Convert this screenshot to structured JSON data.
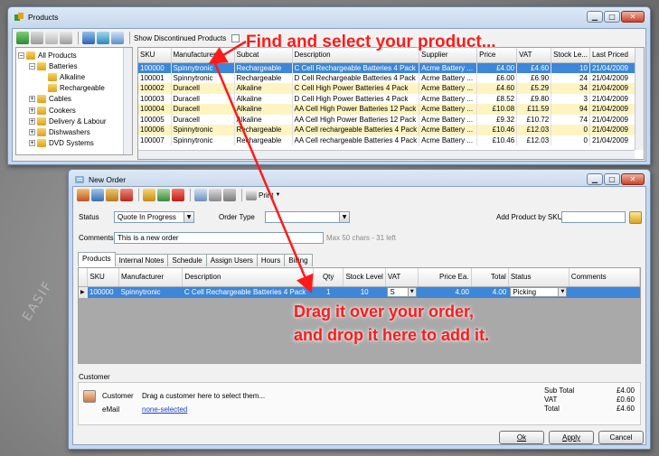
{
  "watermark": "EASIF",
  "products_window": {
    "title": "Products",
    "show_discontinued_label": "Show Discontinued Products",
    "tree": [
      {
        "label": "All Products",
        "expander": "−"
      },
      {
        "label": "Batteries",
        "expander": "−"
      },
      {
        "label": "Alkaline",
        "expander": ""
      },
      {
        "label": "Rechargeable",
        "expander": ""
      },
      {
        "label": "Cables",
        "expander": "+"
      },
      {
        "label": "Cookers",
        "expander": "+"
      },
      {
        "label": "Delivery & Labour",
        "expander": "+"
      },
      {
        "label": "Dishwashers",
        "expander": "+"
      },
      {
        "label": "DVD Systems",
        "expander": "+"
      }
    ],
    "columns": [
      "SKU",
      "Manufacturer",
      "Subcat",
      "Description",
      "Supplier",
      "Price",
      "VAT",
      "Stock Le...",
      "Last Priced"
    ],
    "rows": [
      [
        "100000",
        "Spinnytronic",
        "Rechargeable",
        "C Cell Rechargeable Batteries 4 Pack",
        "Acme Battery ...",
        "£4.00",
        "£4.60",
        "10",
        "21/04/2009"
      ],
      [
        "100001",
        "Spinnytronic",
        "Rechargeable",
        "D Cell Rechargeable Batteries 4 Pack",
        "Acme Battery ...",
        "£6.00",
        "£6.90",
        "24",
        "21/04/2009"
      ],
      [
        "100002",
        "Duracell",
        "Alkaline",
        "C Cell High Power Batteries 4 Pack",
        "Acme Battery ...",
        "£4.60",
        "£5.29",
        "34",
        "21/04/2009"
      ],
      [
        "100003",
        "Duracell",
        "Alkaline",
        "D Cell High Power Batteries 4 Pack",
        "Acme Battery ...",
        "£8.52",
        "£9.80",
        "3",
        "21/04/2009"
      ],
      [
        "100004",
        "Duracell",
        "Alkaline",
        "AA Cell High Power Batteries 12 Pack",
        "Acme Battery ...",
        "£10.08",
        "£11.59",
        "94",
        "21/04/2009"
      ],
      [
        "100005",
        "Duracell",
        "Alkaline",
        "AA Cell High Power Batteries 12 Pack",
        "Acme Battery ...",
        "£9.32",
        "£10.72",
        "74",
        "21/04/2009"
      ],
      [
        "100006",
        "Spinnytronic",
        "Rechargeable",
        "AA Cell rechargeable Batteries 4 Pack",
        "Acme Battery ...",
        "£10.46",
        "£12.03",
        "0",
        "21/04/2009"
      ],
      [
        "100007",
        "Spinnytronic",
        "Rechargeable",
        "AA Cell rechargeable Batteries 4 Pack",
        "Acme Battery ...",
        "£10.46",
        "£12.03",
        "0",
        "21/04/2009"
      ]
    ],
    "row_styles": [
      "sel",
      "",
      "yel",
      "",
      "yel",
      "",
      "yel",
      ""
    ]
  },
  "callouts": {
    "top": "Find and select your product...",
    "bottom_line1": "Drag it over your order,",
    "bottom_line2": "and drop it here to add it."
  },
  "order_window": {
    "title": "New Order",
    "print_label": "Print",
    "status_label": "Status",
    "status_value": "Quote In Progress",
    "order_type_label": "Order Type",
    "order_type_value": "",
    "add_product_label": "Add Product by SKU",
    "sku_input_value": "",
    "comments_label": "Comments",
    "comments_value": "This is a new order",
    "comments_hint": "Max 50 chars - 31 left",
    "tabs": [
      "Products",
      "Internal Notes",
      "Schedule",
      "Assign Users",
      "Hours",
      "Billing"
    ],
    "columns": [
      "SKU",
      "Manufacturer",
      "Description",
      "Qty",
      "Stock Level",
      "VAT",
      "Price Ea.",
      "Total",
      "Status",
      "Comments"
    ],
    "row": {
      "indicator": "▶",
      "sku": "100000",
      "manufacturer": "Spinnytronic",
      "description": "C Cell Rechargeable Batteries 4 Pack",
      "qty": "1",
      "stock": "10",
      "vat": "S",
      "price": "4.00",
      "total": "4.00",
      "status": "Picking",
      "comments": ""
    },
    "customer_section_label": "Customer",
    "customer_label": "Customer",
    "customer_hint": "Drag a customer here to select them...",
    "email_label": "eMail",
    "email_value": "none-selected",
    "totals": [
      {
        "label": "Sub Total",
        "value": "£4.00"
      },
      {
        "label": "VAT",
        "value": "£0.60"
      },
      {
        "label": "Total",
        "value": "£4.60"
      }
    ],
    "buttons": {
      "ok": "Ok",
      "apply": "Apply",
      "cancel": "Cancel"
    }
  },
  "colors": {
    "callout": "#ff1a1a",
    "selection": "#3d86d9",
    "stripe": "#fdf4c2"
  }
}
